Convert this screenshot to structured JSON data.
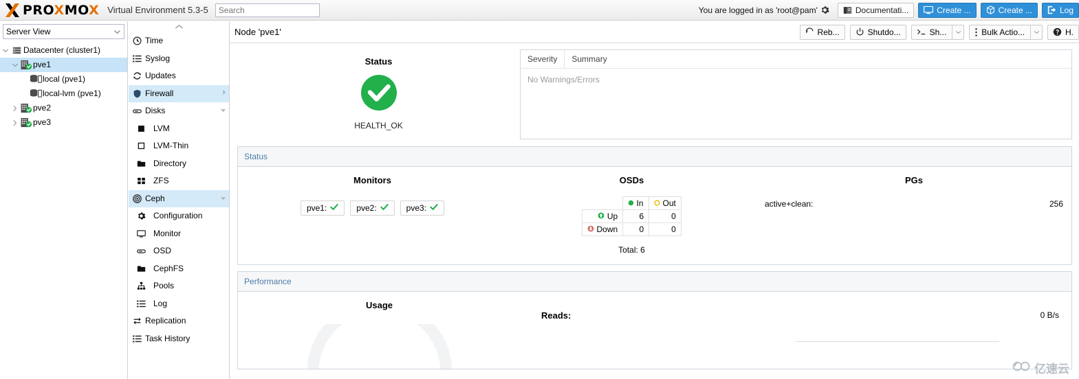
{
  "header": {
    "brand_dark1": "PRO",
    "brand_orange": "X",
    "brand_dark2": "MO",
    "brand_orange2": "X",
    "product": "Virtual Environment 5.3-5",
    "search_placeholder": "Search",
    "search_value": "",
    "logged_in": "You are logged in as 'root@pam'",
    "buttons": [
      {
        "label": "Documentati...",
        "icon": "book-icon",
        "style": "light"
      },
      {
        "label": "Create ...",
        "icon": "monitor-icon",
        "style": "blue"
      },
      {
        "label": "Create ...",
        "icon": "cube-icon",
        "style": "blue"
      },
      {
        "label": "Log",
        "icon": "logout-icon",
        "style": "blue"
      }
    ]
  },
  "sidebar": {
    "view_label": "Server View",
    "tree": [
      {
        "label": "Datacenter (cluster1)",
        "icon": "datacenter-icon",
        "depth": 0,
        "twist": "down",
        "selected": false
      },
      {
        "label": "pve1",
        "icon": "node-icon",
        "depth": 1,
        "twist": "down",
        "selected": true
      },
      {
        "label": "local (pve1)",
        "icon": "storage-icon",
        "depth": 2,
        "twist": "none",
        "selected": false
      },
      {
        "label": "local-lvm (pve1)",
        "icon": "storage-icon",
        "depth": 2,
        "twist": "none",
        "selected": false
      },
      {
        "label": "pve2",
        "icon": "node-icon",
        "depth": 1,
        "twist": "right",
        "selected": false
      },
      {
        "label": "pve3",
        "icon": "node-icon",
        "depth": 1,
        "twist": "right",
        "selected": false
      }
    ]
  },
  "nav": {
    "items": [
      {
        "label": "Time",
        "icon": "clock-icon",
        "child": false,
        "selected": false,
        "arrow": ""
      },
      {
        "label": "Syslog",
        "icon": "list-icon",
        "child": false,
        "selected": false,
        "arrow": ""
      },
      {
        "label": "Updates",
        "icon": "refresh-icon",
        "child": false,
        "selected": false,
        "arrow": ""
      },
      {
        "label": "Firewall",
        "icon": "shield-icon",
        "child": false,
        "selected": true,
        "arrow": "right"
      },
      {
        "label": "Disks",
        "icon": "disk-icon",
        "child": false,
        "selected": false,
        "arrow": "down"
      },
      {
        "label": "LVM",
        "icon": "square-filled-icon",
        "child": true,
        "selected": false,
        "arrow": ""
      },
      {
        "label": "LVM-Thin",
        "icon": "square-outline-icon",
        "child": true,
        "selected": false,
        "arrow": ""
      },
      {
        "label": "Directory",
        "icon": "folder-icon",
        "child": true,
        "selected": false,
        "arrow": ""
      },
      {
        "label": "ZFS",
        "icon": "grid-icon",
        "child": true,
        "selected": false,
        "arrow": ""
      },
      {
        "label": "Ceph",
        "icon": "ceph-icon",
        "child": false,
        "selected": true,
        "arrow": "down"
      },
      {
        "label": "Configuration",
        "icon": "gear-icon",
        "child": true,
        "selected": false,
        "arrow": ""
      },
      {
        "label": "Monitor",
        "icon": "monitor-icon",
        "child": true,
        "selected": false,
        "arrow": ""
      },
      {
        "label": "OSD",
        "icon": "disk-icon",
        "child": true,
        "selected": false,
        "arrow": ""
      },
      {
        "label": "CephFS",
        "icon": "folder-icon",
        "child": true,
        "selected": false,
        "arrow": ""
      },
      {
        "label": "Pools",
        "icon": "sitemap-icon",
        "child": true,
        "selected": false,
        "arrow": ""
      },
      {
        "label": "Log",
        "icon": "list-icon",
        "child": true,
        "selected": false,
        "arrow": ""
      },
      {
        "label": "Replication",
        "icon": "replication-icon",
        "child": false,
        "selected": false,
        "arrow": ""
      },
      {
        "label": "Task History",
        "icon": "list-icon",
        "child": false,
        "selected": false,
        "arrow": ""
      }
    ]
  },
  "content": {
    "node_title": "Node 'pve1'",
    "toolbar": [
      {
        "label": "Reb...",
        "icon": "reboot-icon",
        "split": false
      },
      {
        "label": "Shutdo...",
        "icon": "power-icon",
        "split": false
      },
      {
        "label": "Sh...",
        "icon": "shell-icon",
        "split": true
      },
      {
        "label": "Bulk Actio...",
        "icon": "dots-vertical-icon",
        "split": true
      },
      {
        "label": "H.",
        "icon": "help-icon",
        "split": false
      }
    ],
    "status": {
      "title": "Status",
      "health_text": "HEALTH_OK",
      "health_state": "ok"
    },
    "warnings": {
      "col_severity": "Severity",
      "col_summary": "Summary",
      "empty_text": "No Warnings/Errors"
    },
    "status_section": {
      "section_title": "Status",
      "monitors": {
        "title": "Monitors",
        "entries": [
          {
            "name": "pve1:",
            "state": "ok"
          },
          {
            "name": "pve2:",
            "state": "ok"
          },
          {
            "name": "pve3:",
            "state": "ok"
          }
        ]
      },
      "osds": {
        "title": "OSDs",
        "col_in": "In",
        "col_out": "Out",
        "row_up": "Up",
        "row_down": "Down",
        "up_in": "6",
        "up_out": "0",
        "down_in": "0",
        "down_out": "0",
        "total": "Total: 6"
      },
      "pgs": {
        "title": "PGs",
        "rows": [
          {
            "label": "active+clean:",
            "value": "256"
          }
        ]
      }
    },
    "performance": {
      "section_title": "Performance",
      "usage_title": "Usage",
      "reads_label": "Reads:",
      "reads_value": "0 B/s"
    }
  },
  "watermark": {
    "text": "亿速云"
  },
  "colors": {
    "accent_blue": "#2e90d8",
    "brand_orange": "#e57000",
    "health_green": "#22b04b",
    "section_title": "#4b7ba6",
    "selected_row": "#c6e3f7"
  }
}
